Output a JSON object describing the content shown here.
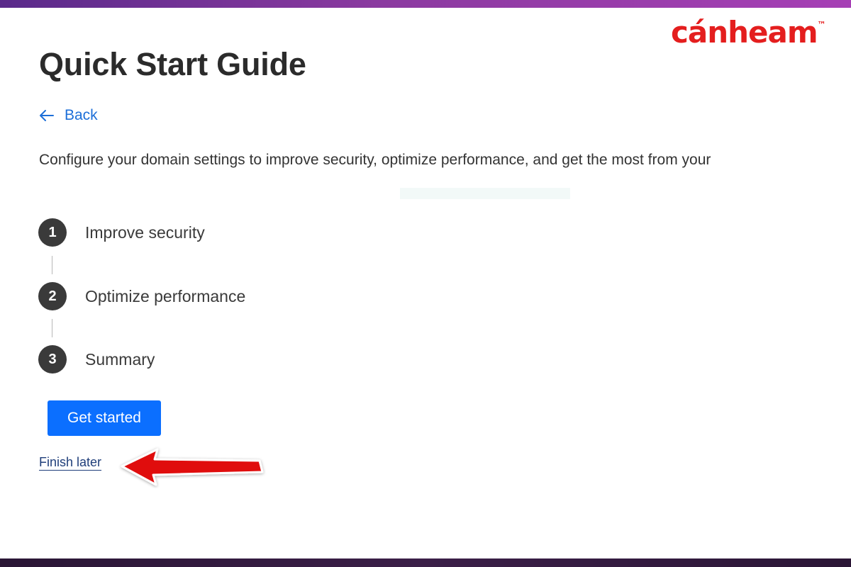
{
  "brand": {
    "logo_text": "cánheam",
    "trademark": "™",
    "color": "#e41e1e"
  },
  "page": {
    "title": "Quick Start Guide",
    "back_label": "Back",
    "back_icon": "arrow-left-icon",
    "description": "Configure your domain settings to improve security, optimize performance, and get the most from your"
  },
  "steps": [
    {
      "number": "1",
      "label": "Improve security"
    },
    {
      "number": "2",
      "label": "Optimize performance"
    },
    {
      "number": "3",
      "label": "Summary"
    }
  ],
  "actions": {
    "primary_label": "Get started",
    "secondary_label": "Finish later"
  },
  "annotation": {
    "icon": "red-arrow-annotation-icon",
    "color": "#e00d0d"
  },
  "colors": {
    "accent": "#0b6fff",
    "link": "#1d6fd8",
    "step_badge": "#3a3a3a",
    "top_band": "#8b3aa0"
  }
}
